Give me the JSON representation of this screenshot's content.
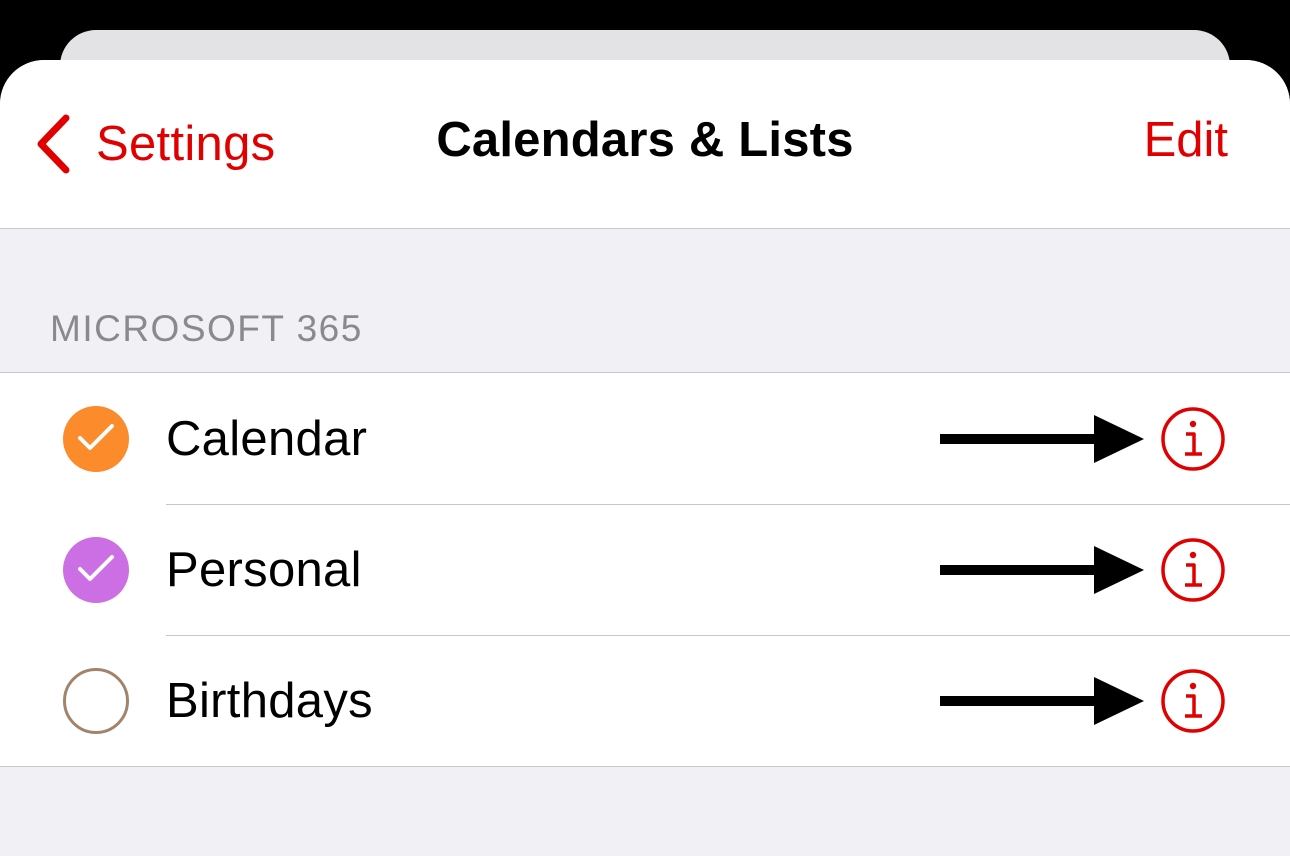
{
  "colors": {
    "accent": "#e10000",
    "calendar": "#fb8b2b",
    "personal": "#cd6fe4",
    "birthdays": "#a2846c"
  },
  "navbar": {
    "back_label": "Settings",
    "back_icon": "chevron-left-icon",
    "title": "Calendars & Lists",
    "edit_label": "Edit"
  },
  "section": {
    "header": "MICROSOFT 365",
    "items": [
      {
        "label": "Calendar",
        "checked": true,
        "color": "#fb8b2b",
        "icon": "checkmark-icon"
      },
      {
        "label": "Personal",
        "checked": true,
        "color": "#cd6fe4",
        "icon": "checkmark-icon"
      },
      {
        "label": "Birthdays",
        "checked": false,
        "color": "#a2846c",
        "icon": "empty-circle-icon"
      }
    ]
  },
  "annotation_icon": "right-arrow-icon",
  "info_icon": "info-circle-icon"
}
